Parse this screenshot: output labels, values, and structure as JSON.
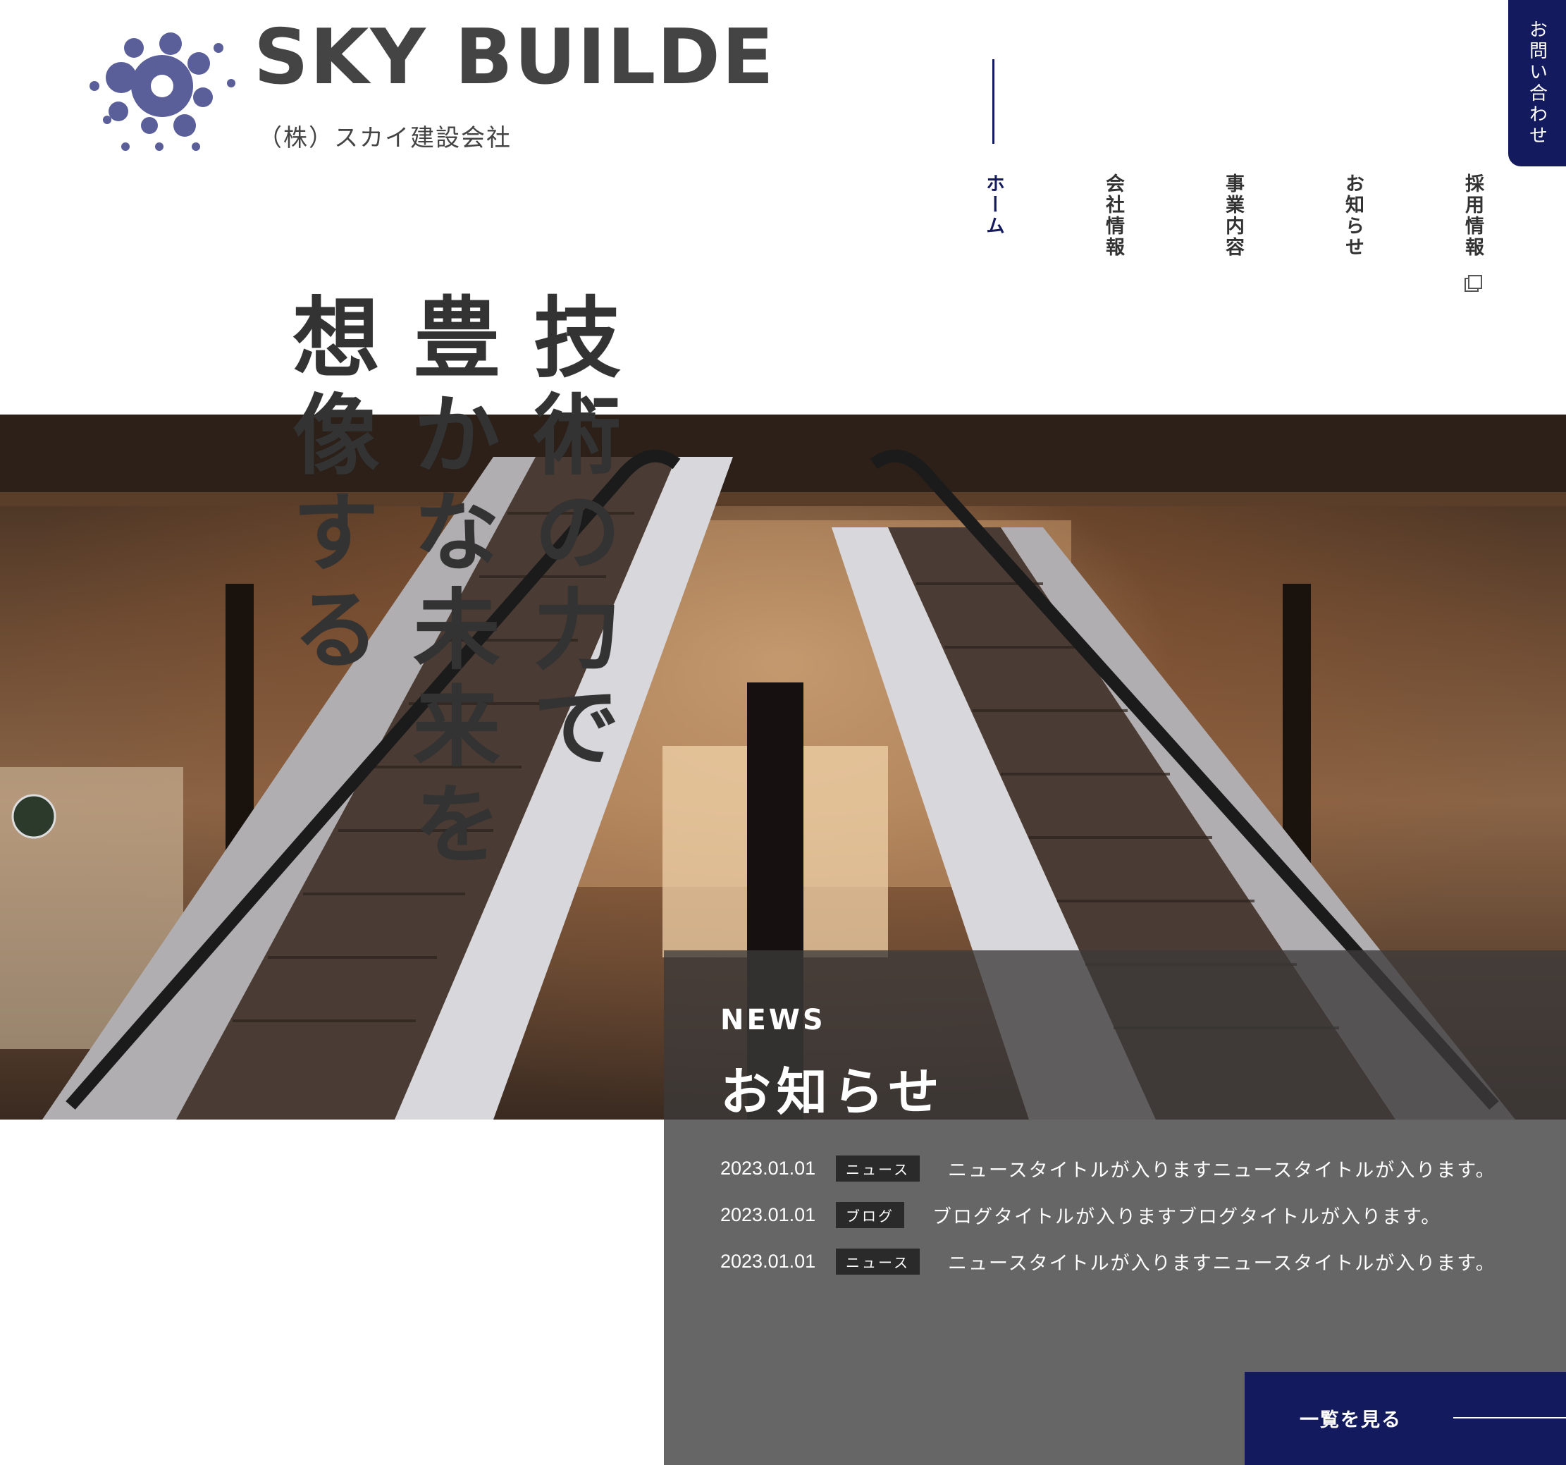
{
  "brand": {
    "logo_icon": "molecule-logo-icon",
    "name": "SKY BUILDE",
    "subname": "（株）スカイ建設会社",
    "color": "#5a5f9a"
  },
  "nav": {
    "items": [
      {
        "label": "ホーム",
        "active": true
      },
      {
        "label": "会社情報"
      },
      {
        "label": "事業内容"
      },
      {
        "label": "お知らせ"
      },
      {
        "label": "採用情報",
        "icon": "external-link-icon"
      }
    ],
    "accent": "#141a5e"
  },
  "contact": {
    "label": "お問い合わせ"
  },
  "hero": {
    "catch_lines": [
      "技術の力で",
      "豊かな未来を",
      "想像する"
    ],
    "image": "escalator-mall-photo"
  },
  "news": {
    "heading_en": "NEWS",
    "heading_ja": "お知らせ",
    "items": [
      {
        "date": "2023.01.01",
        "tag": "ニュース",
        "title": "ニュースタイトルが入りますニュースタイトルが入ります。"
      },
      {
        "date": "2023.01.01",
        "tag": "ブログ",
        "title": "ブログタイトルが入りますブログタイトルが入ります。"
      },
      {
        "date": "2023.01.01",
        "tag": "ニュース",
        "title": "ニュースタイトルが入りますニュースタイトルが入ります。"
      }
    ],
    "more_label": "一覧を見る"
  }
}
